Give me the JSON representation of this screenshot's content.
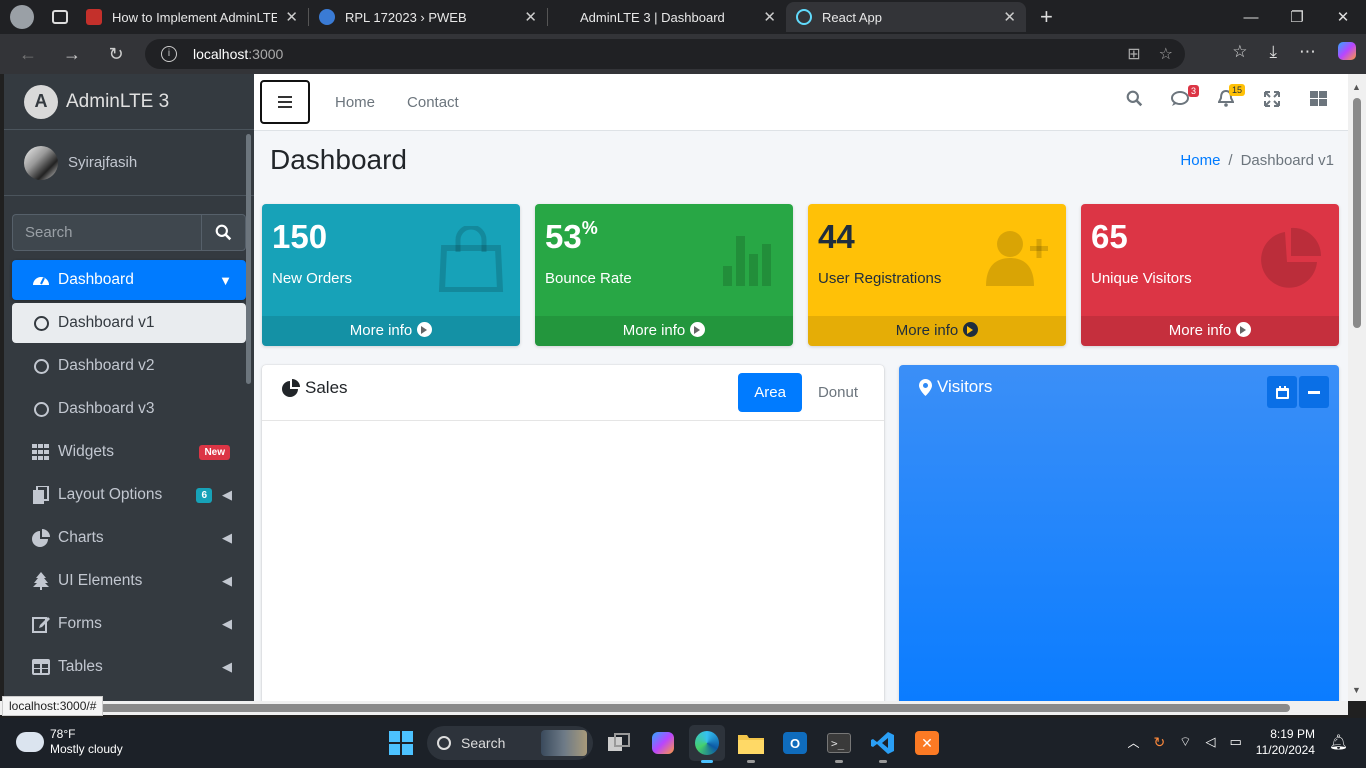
{
  "browser": {
    "tabs": [
      {
        "title": "How to Implement AdminLTE in R",
        "favicon_color": "#c4302b",
        "active": false
      },
      {
        "title": "RPL 172023 › PWEB",
        "favicon_color": "#3a7bd5",
        "active": false
      },
      {
        "title": "AdminLTE 3 | Dashboard",
        "favicon_color": "",
        "active": false
      },
      {
        "title": "React App",
        "favicon_color": "#61dafb",
        "active": true
      }
    ],
    "url_host": "localhost",
    "url_port": ":3000",
    "status_url": "localhost:3000/#"
  },
  "sidebar": {
    "brand": "AdminLTE 3",
    "brand_logo": "A",
    "user": "Syirajfasih",
    "search_placeholder": "Search",
    "items": [
      {
        "label": "Dashboard",
        "icon": "tachometer-icon"
      },
      {
        "label": "Dashboard v1",
        "icon": "circle-icon"
      },
      {
        "label": "Dashboard v2",
        "icon": "circle-icon"
      },
      {
        "label": "Dashboard v3",
        "icon": "circle-icon"
      },
      {
        "label": "Widgets",
        "icon": "grid-icon",
        "badge": "New"
      },
      {
        "label": "Layout Options",
        "icon": "copy-icon",
        "badge": "6"
      },
      {
        "label": "Charts",
        "icon": "pie-chart-icon"
      },
      {
        "label": "UI Elements",
        "icon": "tree-icon"
      },
      {
        "label": "Forms",
        "icon": "edit-icon"
      },
      {
        "label": "Tables",
        "icon": "table-icon"
      }
    ]
  },
  "topnav": {
    "links": [
      "Home",
      "Contact"
    ],
    "messages_count": "3",
    "notifications_count": "15"
  },
  "header": {
    "title": "Dashboard",
    "breadcrumb_home": "Home",
    "breadcrumb_current": "Dashboard v1"
  },
  "stats": [
    {
      "value": "150",
      "suffix": "",
      "label": "New Orders",
      "link": "More info",
      "color": "#17a2b8",
      "icon": "shopping-bag-icon"
    },
    {
      "value": "53",
      "suffix": "%",
      "label": "Bounce Rate",
      "link": "More info",
      "color": "#28a745",
      "icon": "bar-chart-icon"
    },
    {
      "value": "44",
      "suffix": "",
      "label": "User Registrations",
      "link": "More info",
      "color": "#ffc107",
      "icon": "user-plus-icon"
    },
    {
      "value": "65",
      "suffix": "",
      "label": "Unique Visitors",
      "link": "More info",
      "color": "#dc3545",
      "icon": "pie-chart-icon"
    }
  ],
  "sales_card": {
    "title": "Sales",
    "tab_area": "Area",
    "tab_donut": "Donut"
  },
  "visitors_card": {
    "title": "Visitors"
  },
  "taskbar": {
    "temp": "78°F",
    "weather": "Mostly cloudy",
    "search": "Search",
    "time": "8:19 PM",
    "date": "11/20/2024"
  }
}
